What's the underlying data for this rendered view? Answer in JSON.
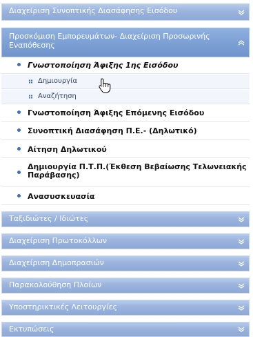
{
  "menu": {
    "header_top": "Διαχείριση Συνοπτικής Διασάφησης Εισόδου",
    "header_open": "Προσκόμιση Εμπορευμάτων- Διαχείριση Προσωρινής Εναπόθεσης",
    "items": [
      "Γνωστοποίηση Άφιξης 1ης Εισόδου",
      "Γνωστοποίηση Άφιξης Επόμενης Εισόδου",
      "Συνοπτική Διασάφηση Π.Ε.- (Δηλωτικό)",
      "Αίτηση Δηλωτικού",
      "Δημιουργία Π.Τ.Π.(Έκθεση Βεβαίωσης Τελωνειακής Παράβασης)",
      "Ανασυσκευασία"
    ],
    "subitems": [
      "Δημιουργία",
      "Αναζήτηση"
    ],
    "sections_bottom": [
      "Ταξιδιώτες / Ιδιώτες",
      "Διαχείριση Πρωτοκόλλων",
      "Διαχείριση Δημοπρασιών",
      "Παρακολούθηση Πλοίων",
      "Υποστηρικτικές Λειτουργίες",
      "Εκτυπώσεις"
    ]
  },
  "colors": {
    "header_bg": "#9ab4de",
    "header_open_bg": "#7c9fd4",
    "bullet": "#3e6fbf",
    "text": "#111111"
  },
  "icons": {
    "chevron_down": "chevron-down-icon",
    "chevron_up": "chevron-up-icon",
    "bullet": "bullet-icon",
    "square_bullet": "square-bullet-icon",
    "cursor": "hand-cursor-icon"
  }
}
